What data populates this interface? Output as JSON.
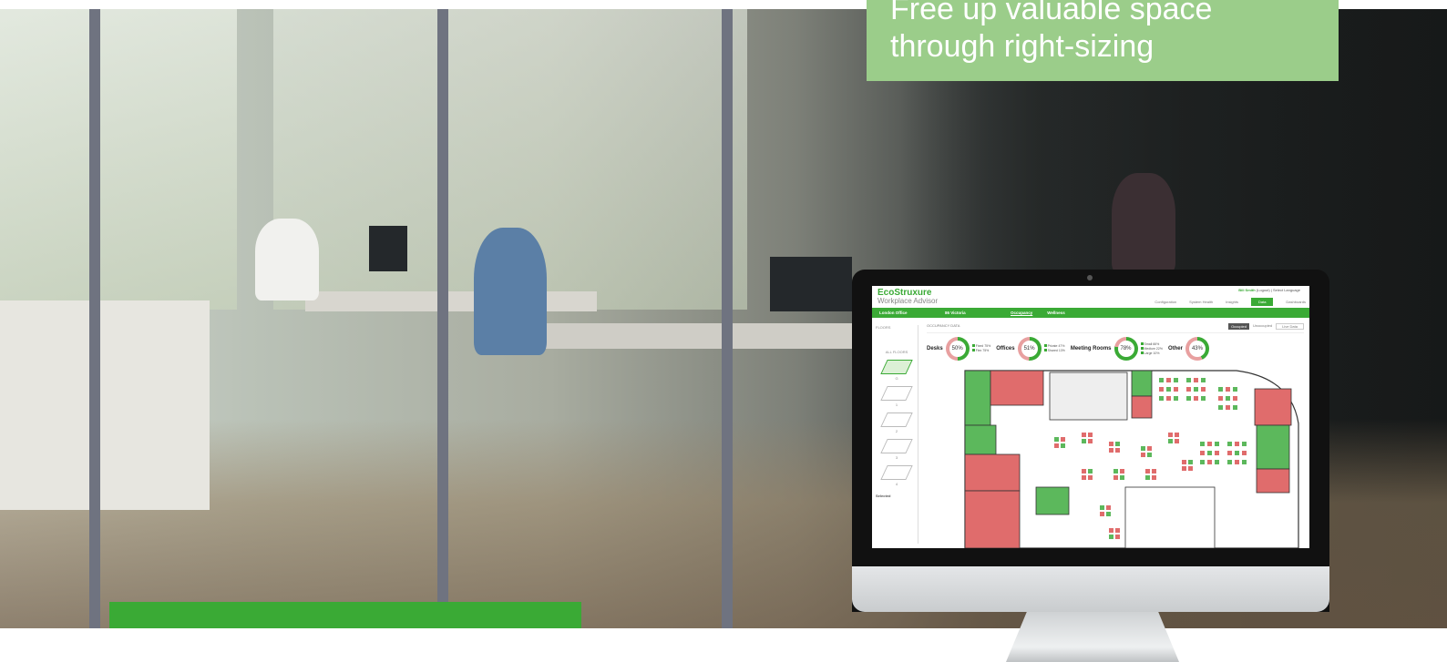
{
  "headline": {
    "line1": "Free up valuable space",
    "line2": "through right-sizing"
  },
  "app": {
    "logo": "EcoStruxure",
    "subtitle": "Workplace Advisor",
    "user": "Bill Smith",
    "logout": "(Logout)",
    "language": "Select Language",
    "nav": [
      {
        "label": "Configuration"
      },
      {
        "label": "System Health"
      },
      {
        "label": "Insights"
      },
      {
        "label": "Data"
      },
      {
        "label": "Dashboards"
      }
    ],
    "site": "London Office",
    "building": "86 Victoria",
    "subnav": [
      "Occupancy",
      "Wellness"
    ],
    "floors_title": "FLOORS",
    "all_floors": "ALL FLOORS",
    "floor_labels": [
      "G",
      "1",
      "2",
      "3",
      "4"
    ],
    "selected_label": "Selected",
    "occupancy_title": "OCCUPANCY DATA",
    "toggle": [
      "Occupied",
      "Unoccupied"
    ],
    "live": "Live Data",
    "stats": [
      {
        "label": "Desks",
        "value": "50%",
        "pct": 50,
        "legend": [
          "Fixed 75%",
          "Flex 75%"
        ]
      },
      {
        "label": "Offices",
        "value": "51%",
        "pct": 51,
        "legend": [
          "Private 47%",
          "Shared 13%"
        ]
      },
      {
        "label": "Meeting Rooms",
        "value": "78%",
        "pct": 78,
        "legend": [
          "Small 66%",
          "Medium 22%",
          "Large 10%"
        ]
      },
      {
        "label": "Other",
        "value": "43%",
        "pct": 43,
        "legend": []
      }
    ]
  },
  "colors": {
    "brand_green": "#3aaa35",
    "light_green": "#9bcd8a",
    "occupied_red": "#e06c6c",
    "free_green": "#5cb85c"
  }
}
